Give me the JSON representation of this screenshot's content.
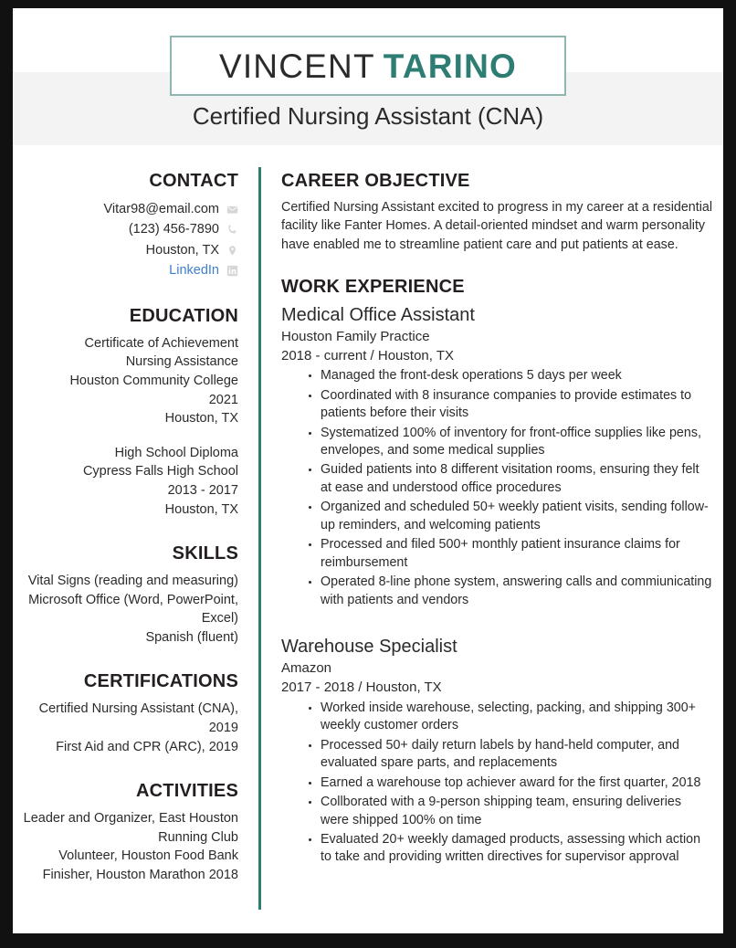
{
  "theme": {
    "accent": "#2e7d73",
    "accent_border": "#8fb7b2",
    "band": "#f3f3f3",
    "text": "#2b2b2b",
    "link": "#3f7fd0",
    "icon": "#d6d6d6",
    "frame": "#111111"
  },
  "header": {
    "first_name": "VINCENT",
    "last_name": "TARINO",
    "subtitle": "Certified Nursing Assistant (CNA)"
  },
  "contact": {
    "heading": "CONTACT",
    "items": [
      {
        "text": "Vitar98@email.com",
        "icon": "envelope-icon",
        "is_link": false
      },
      {
        "text": "(123) 456-7890",
        "icon": "phone-icon",
        "is_link": false
      },
      {
        "text": "Houston, TX",
        "icon": "location-pin-icon",
        "is_link": false
      },
      {
        "text": "LinkedIn",
        "icon": "linkedin-icon",
        "is_link": true
      }
    ]
  },
  "education": {
    "heading": "EDUCATION",
    "entries": [
      {
        "lines": [
          "Certificate of Achievement",
          "Nursing Assistance",
          "Houston Community College",
          "2021",
          "Houston, TX"
        ]
      },
      {
        "lines": [
          "High School Diploma",
          "Cypress Falls High School",
          "2013 - 2017",
          "Houston, TX"
        ]
      }
    ]
  },
  "skills": {
    "heading": "SKILLS",
    "items": [
      "Vital Signs (reading and measuring)",
      "Microsoft Office (Word, PowerPoint, Excel)",
      "Spanish (fluent)"
    ]
  },
  "certifications": {
    "heading": "CERTIFICATIONS",
    "items": [
      "Certified Nursing Assistant (CNA), 2019",
      "First Aid and CPR (ARC), 2019"
    ]
  },
  "activities": {
    "heading": "ACTIVITIES",
    "items": [
      "Leader and Organizer, East Houston Running Club",
      "Volunteer, Houston Food Bank",
      "Finisher, Houston Marathon 2018"
    ]
  },
  "career_objective": {
    "heading": "CAREER OBJECTIVE",
    "text": "Certified Nursing Assistant excited to progress in my career at a residential facility like Fanter Homes. A detail-oriented mindset and warm personality have enabled me to streamline patient care and put patients at ease."
  },
  "work_experience": {
    "heading": "WORK EXPERIENCE",
    "jobs": [
      {
        "title": "Medical Office Assistant",
        "company": "Houston Family Practice",
        "meta": "2018 - current  /  Houston, TX",
        "bullets": [
          "Managed the front-desk operations 5 days per week",
          "Coordinated with 8 insurance companies to provide estimates to patients before their visits",
          "Systematized 100% of inventory for front-office supplies like pens, envelopes, and some medical supplies",
          "Guided patients into 8 different visitation rooms, ensuring they felt at ease and understood office procedures",
          "Organized and scheduled 50+ weekly patient visits, sending follow-up reminders, and welcoming patients",
          "Processed and filed 500+ monthly patient insurance claims for reimbursement",
          "Operated 8-line phone system, answering calls and commiunicating with patients and vendors"
        ]
      },
      {
        "title": "Warehouse Specialist",
        "company": "Amazon",
        "meta": "2017 - 2018  /  Houston, TX",
        "bullets": [
          "Worked inside warehouse, selecting, packing, and shipping 300+ weekly customer orders",
          "Processed 50+ daily return labels by hand-held computer, and evaluated spare parts, and replacements",
          "Earned a warehouse top achiever award for the first quarter, 2018",
          "Collborated with a 9-person shipping team, ensuring deliveries were shipped 100% on time",
          "Evaluated 20+ weekly damaged products, assessing which action to take and providing written directives for supervisor approval"
        ]
      }
    ]
  }
}
